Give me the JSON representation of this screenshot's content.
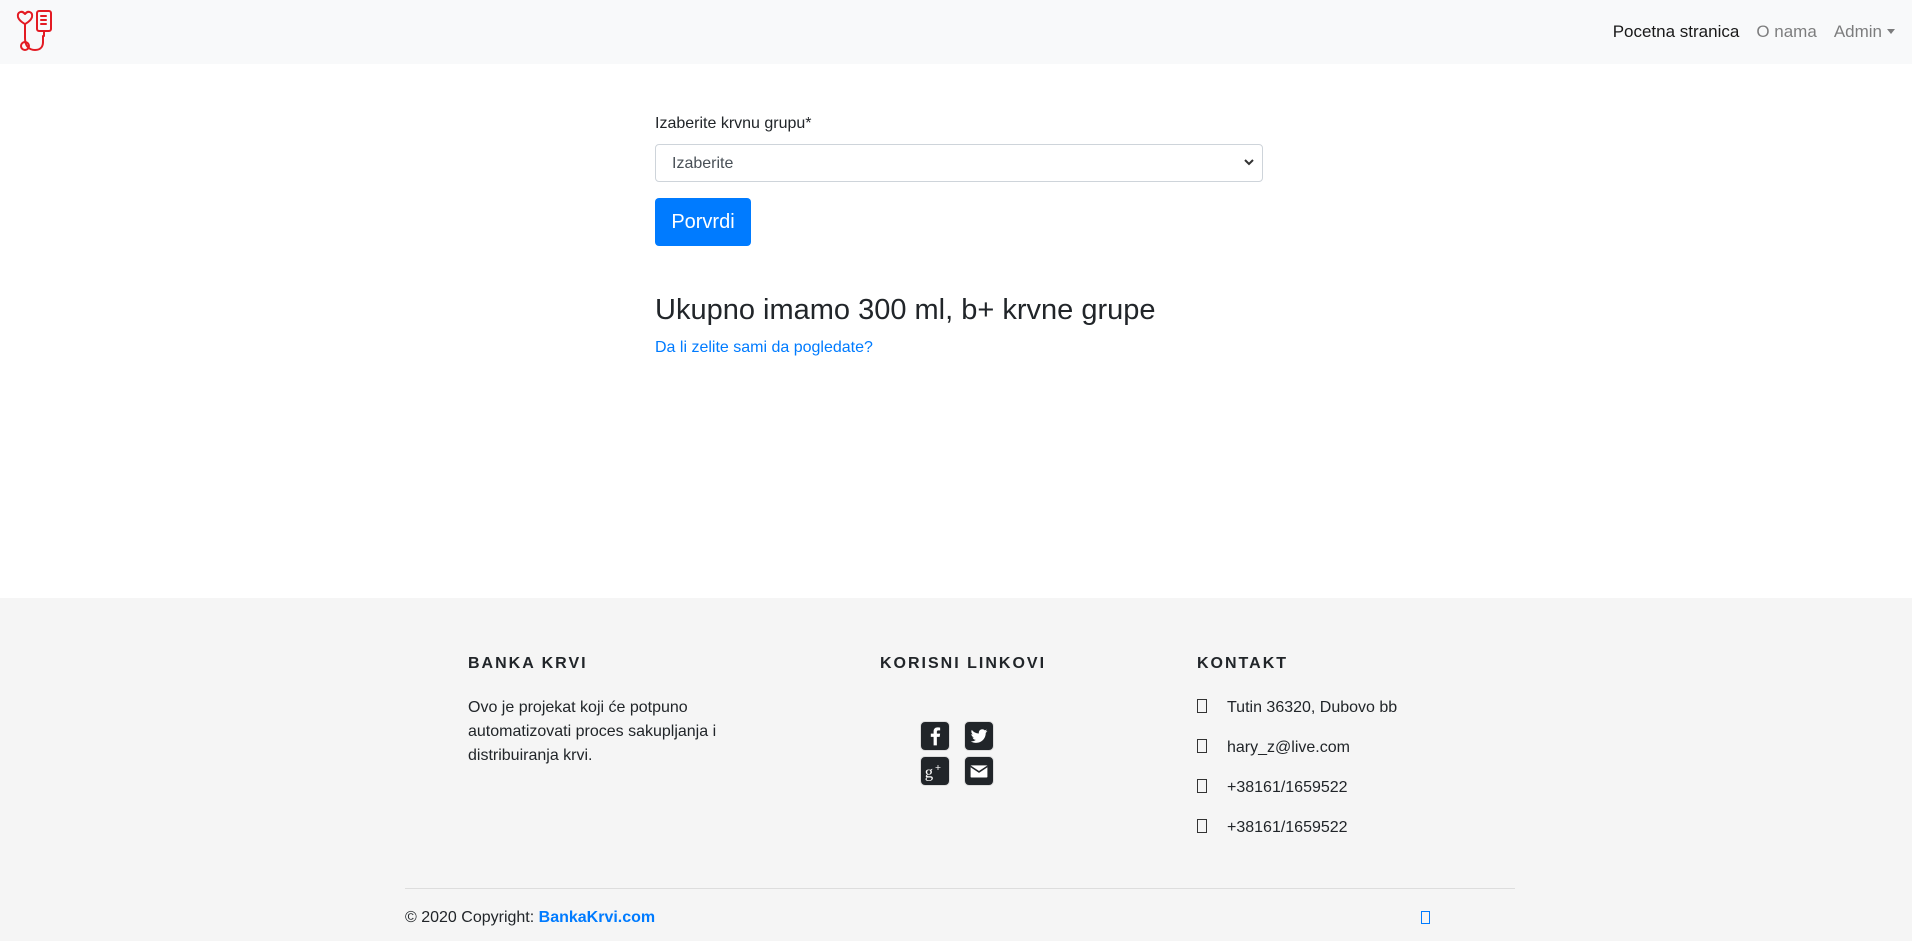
{
  "navbar": {
    "logo": "blood-bank-logo",
    "links": [
      {
        "label": "Pocetna stranica",
        "active": true
      },
      {
        "label": "O nama",
        "active": false
      },
      {
        "label": "Admin",
        "active": false
      }
    ]
  },
  "form": {
    "label": "Izaberite krvnu grupu*",
    "select_value": "Izaberite",
    "submit_label": "Porvrdi"
  },
  "result": {
    "heading": "Ukupno imamo 300 ml, b+ krvne grupe",
    "link": "Da li zelite sami da pogledate?"
  },
  "footer": {
    "about_title": "BANKA KRVI",
    "about_text": "Ovo je projekat koji će potpuno automatizovati proces sakupljanja i distribuiranja krvi.",
    "links_title": "KORISNI LINKOVI",
    "social_icons": [
      "facebook-icon",
      "twitter-icon",
      "google-plus-icon",
      "envelope-icon"
    ],
    "contact_title": "KONTAKT",
    "contact": {
      "address": "Tutin 36320, Dubovo bb",
      "email": "hary_z@live.com",
      "phone1": "+38161/1659522",
      "phone2": "+38161/1659522"
    },
    "copyright_prefix": "© 2020 Copyright:",
    "copyright_link": "BankaKrvi.com"
  },
  "colors": {
    "primary": "#007bff",
    "logo_red": "#e31b23",
    "navbar_bg": "#f8f9fa",
    "footer_bg": "#f5f5f5"
  }
}
